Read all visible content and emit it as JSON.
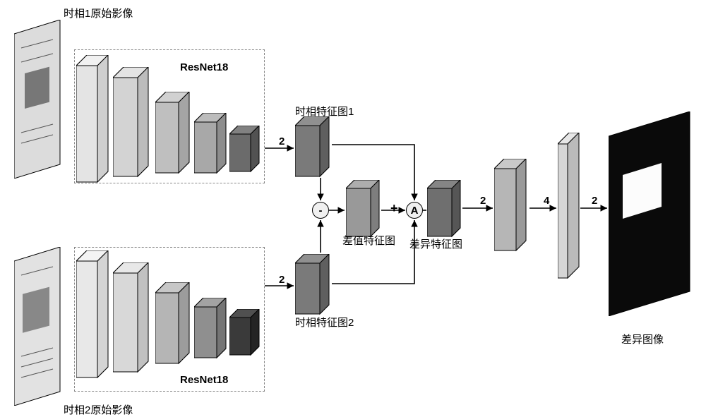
{
  "labels": {
    "input1": "时相1原始影像",
    "input2": "时相2原始影像",
    "resnet1": "ResNet18",
    "resnet2": "ResNet18",
    "feat1": "时相特征图1",
    "feat2": "时相特征图2",
    "diff_feat": "差值特征图",
    "variance_feat": "差异特征图",
    "output": "差异图像"
  },
  "arrow_nums": {
    "a1": "2",
    "a2": "2",
    "a3": "2",
    "a4": "4",
    "a5": "2"
  },
  "ops": {
    "minus": "-",
    "plus": "+",
    "attn": "A"
  },
  "chart_data": {
    "type": "diagram",
    "title": "Siamese ResNet18 change-detection architecture",
    "branches": [
      {
        "name": "时相1原始影像",
        "backbone": "ResNet18",
        "stages": 5,
        "upsample": 2,
        "output": "时相特征图1"
      },
      {
        "name": "时相2原始影像",
        "backbone": "ResNet18",
        "stages": 5,
        "upsample": 2,
        "output": "时相特征图2"
      }
    ],
    "fusion": [
      {
        "op": "-",
        "inputs": [
          "时相特征图1",
          "时相特征图2"
        ],
        "output": "差值特征图"
      },
      {
        "op": "A (attention)",
        "inputs": [
          "时相特征图1",
          "差值特征图",
          "时相特征图2"
        ],
        "aux_op": "+",
        "output": "差异特征图"
      }
    ],
    "decoder_upsample_factors": [
      2,
      4,
      2
    ],
    "final_output": "差异图像"
  }
}
